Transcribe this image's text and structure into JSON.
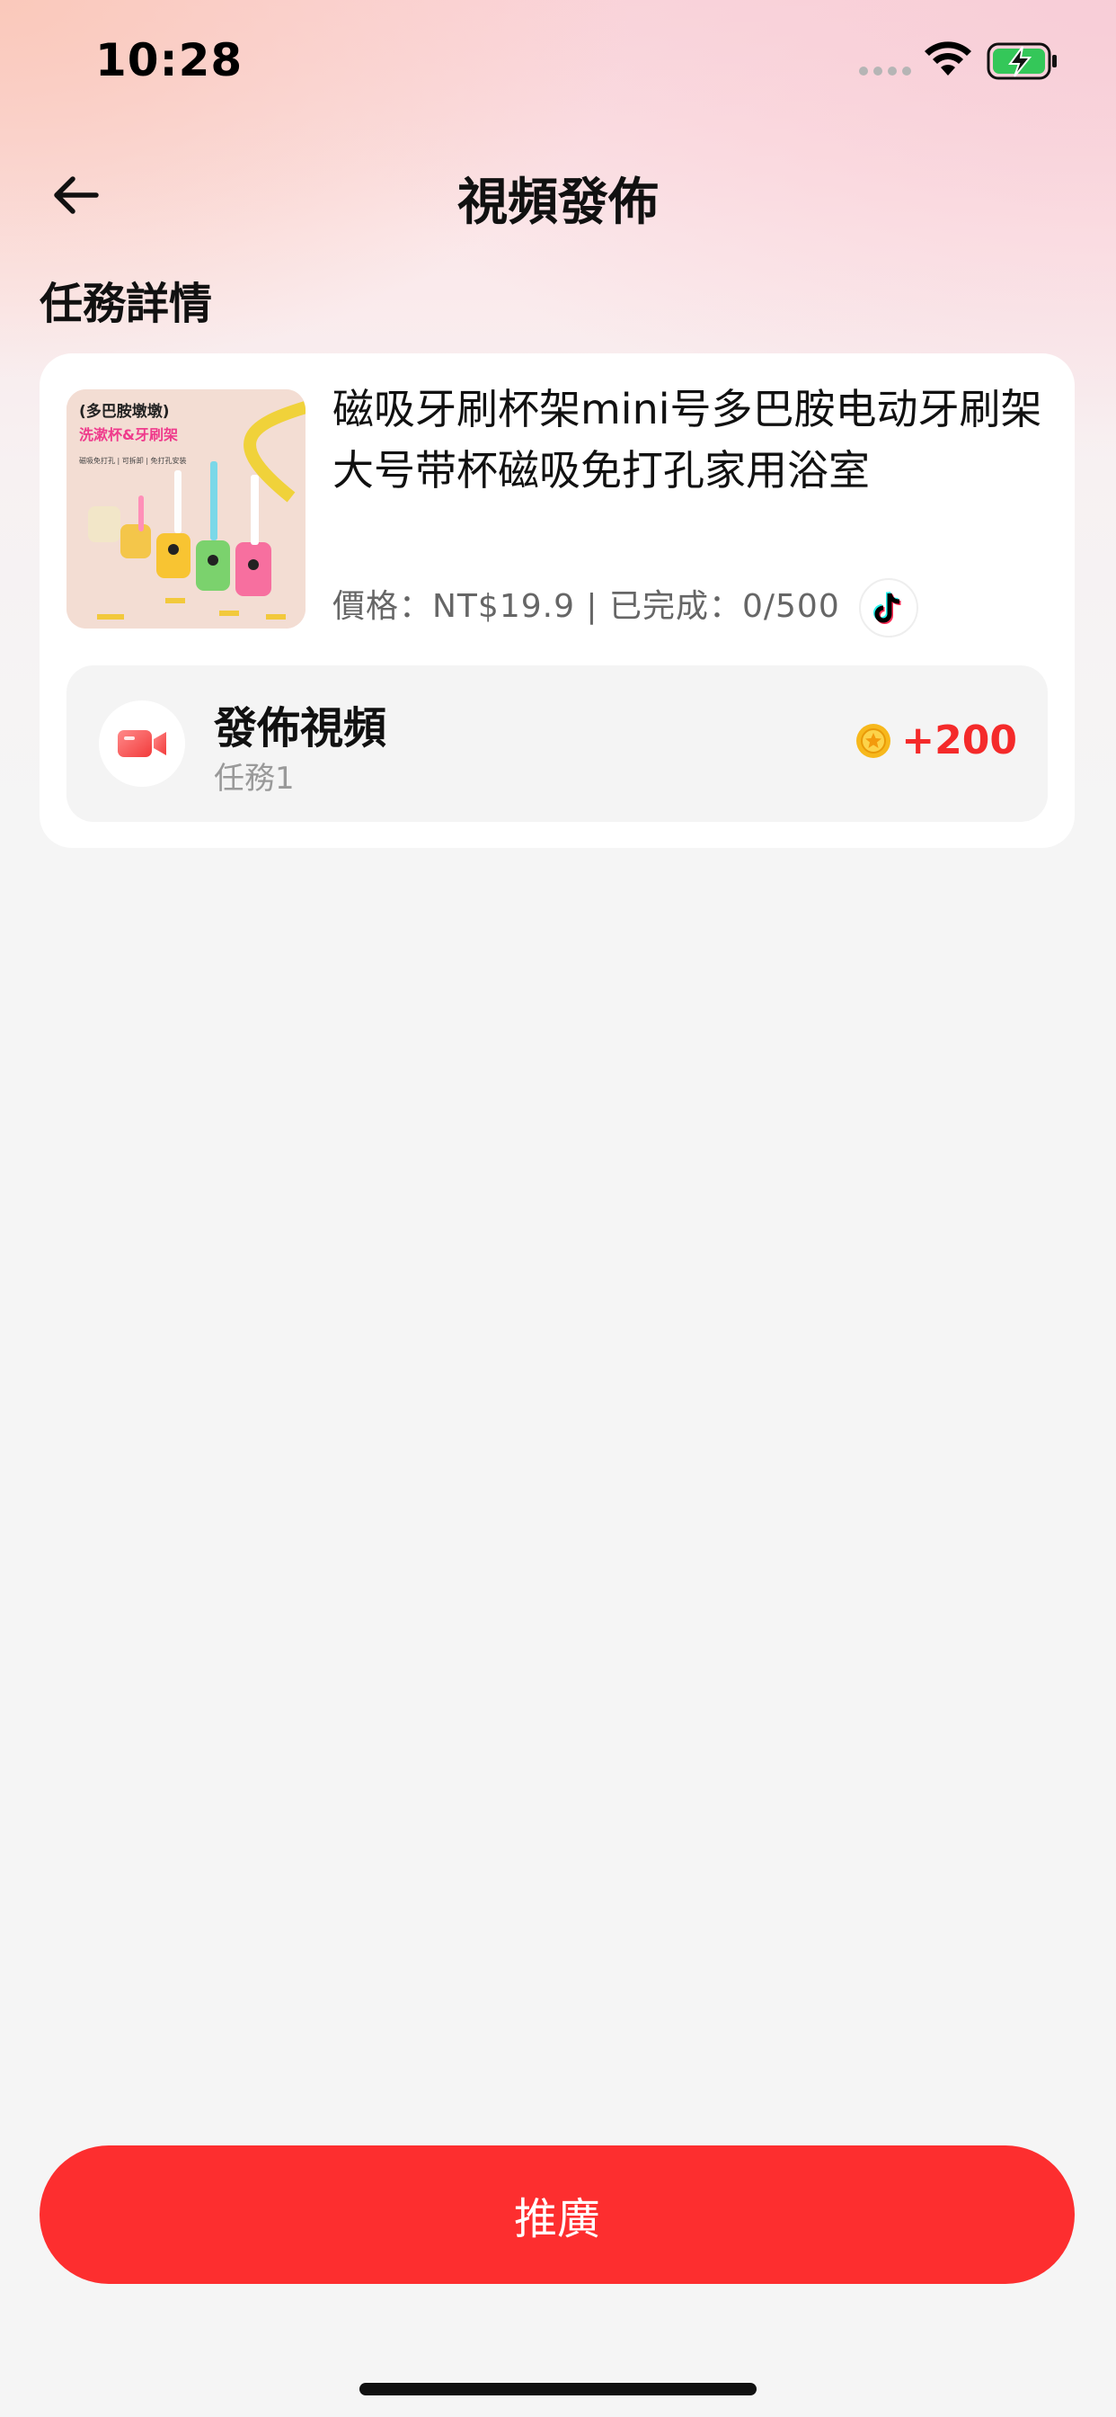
{
  "status_bar": {
    "time": "10:28"
  },
  "nav": {
    "title": "視頻發佈"
  },
  "section": {
    "title": "任務詳情"
  },
  "product": {
    "title": "磁吸牙刷杯架mini号多巴胺电动牙刷架大号带杯磁吸免打孔家用浴室",
    "meta": "價格：NT$19.9 | 已完成：0/500",
    "platform_icon": "tiktok-icon",
    "image_text": {
      "banner": "(多巴胺墩墩)",
      "subtitle": "洗漱杯&牙刷架",
      "features": "磁吸免打孔 | 可拆卸 | 免打孔安装"
    }
  },
  "sub_task": {
    "title": "發佈視頻",
    "label": "任務1",
    "reward": "+200",
    "icon": "video-camera-icon"
  },
  "footer": {
    "button_label": "推廣"
  },
  "colors": {
    "accent": "#fd2e2f",
    "reward": "#f42a2a",
    "card": "#ffffff",
    "background": "#f5f5f5"
  }
}
